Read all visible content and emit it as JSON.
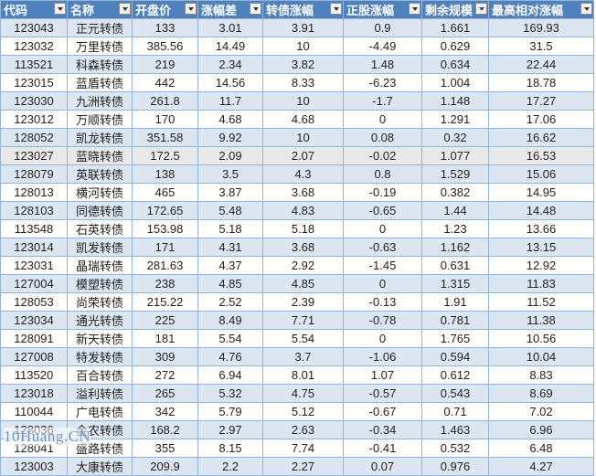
{
  "columns": [
    {
      "label": "代码",
      "filter_sorted": false
    },
    {
      "label": "名称",
      "filter_sorted": false
    },
    {
      "label": "开盘价",
      "filter_sorted": false
    },
    {
      "label": "涨幅差",
      "filter_sorted": false
    },
    {
      "label": "转债涨幅",
      "filter_sorted": false
    },
    {
      "label": "正股涨幅",
      "filter_sorted": false
    },
    {
      "label": "剩余规模",
      "filter_sorted": true
    },
    {
      "label": "最高相对涨幅",
      "filter_sorted": false
    }
  ],
  "rows": [
    [
      "123043",
      "正元转债",
      "133",
      "3.01",
      "3.91",
      "0.9",
      "1.661",
      "169.93"
    ],
    [
      "123032",
      "万里转债",
      "385.56",
      "14.49",
      "10",
      "-4.49",
      "0.629",
      "31.5"
    ],
    [
      "113521",
      "科森转债",
      "219",
      "2.34",
      "3.82",
      "1.48",
      "0.634",
      "22.44"
    ],
    [
      "123015",
      "蓝盾转债",
      "442",
      "14.56",
      "8.33",
      "-6.23",
      "1.004",
      "18.78"
    ],
    [
      "123030",
      "九洲转债",
      "261.8",
      "11.7",
      "10",
      "-1.7",
      "1.148",
      "17.27"
    ],
    [
      "123012",
      "万顺转债",
      "170",
      "4.68",
      "4.68",
      "0",
      "1.291",
      "17.06"
    ],
    [
      "128052",
      "凯龙转债",
      "351.58",
      "9.92",
      "10",
      "0.08",
      "0.32",
      "16.62"
    ],
    [
      "123027",
      "蓝晓转债",
      "172.5",
      "2.09",
      "2.07",
      "-0.02",
      "1.077",
      "16.53"
    ],
    [
      "128079",
      "英联转债",
      "138",
      "3.5",
      "4.3",
      "0.8",
      "1.529",
      "15.06"
    ],
    [
      "128013",
      "横河转债",
      "465",
      "3.87",
      "3.68",
      "-0.19",
      "0.382",
      "14.95"
    ],
    [
      "128103",
      "同德转债",
      "172.65",
      "5.48",
      "4.83",
      "-0.65",
      "1.44",
      "14.48"
    ],
    [
      "113548",
      "石英转债",
      "153.98",
      "5.18",
      "5.18",
      "0",
      "1.23",
      "13.66"
    ],
    [
      "123014",
      "凯发转债",
      "171",
      "4.31",
      "3.68",
      "-0.63",
      "1.162",
      "13.15"
    ],
    [
      "123031",
      "晶瑞转债",
      "281.63",
      "4.37",
      "2.92",
      "-1.45",
      "0.631",
      "12.92"
    ],
    [
      "127004",
      "模塑转债",
      "238",
      "4.85",
      "4.85",
      "0",
      "1.315",
      "11.83"
    ],
    [
      "128053",
      "尚荣转债",
      "215.22",
      "2.52",
      "2.39",
      "-0.13",
      "1.91",
      "11.52"
    ],
    [
      "123034",
      "通光转债",
      "225",
      "8.49",
      "7.71",
      "-0.78",
      "0.781",
      "11.38"
    ],
    [
      "128091",
      "新天转债",
      "181",
      "5.54",
      "5.54",
      "0",
      "1.765",
      "10.56"
    ],
    [
      "127008",
      "特发转债",
      "309",
      "4.76",
      "3.7",
      "-1.06",
      "0.594",
      "10.04"
    ],
    [
      "113520",
      "百合转债",
      "272",
      "6.94",
      "8.01",
      "1.07",
      "0.612",
      "8.83"
    ],
    [
      "123018",
      "溢利转债",
      "265",
      "5.32",
      "4.75",
      "-0.57",
      "0.543",
      "8.69"
    ],
    [
      "110044",
      "广电转债",
      "342",
      "5.79",
      "5.12",
      "-0.67",
      "0.71",
      "7.02"
    ],
    [
      "128036",
      "金农转债",
      "168.2",
      "2.97",
      "2.63",
      "-0.34",
      "1.463",
      "6.96"
    ],
    [
      "128041",
      "盛路转债",
      "355",
      "8.15",
      "7.74",
      "-0.41",
      "0.532",
      "6.48"
    ],
    [
      "123003",
      "大康转债",
      "209.9",
      "2.2",
      "2.27",
      "0.07",
      "0.976",
      "4.27"
    ]
  ],
  "selected_row": 7,
  "watermark": "10Huang.CN"
}
